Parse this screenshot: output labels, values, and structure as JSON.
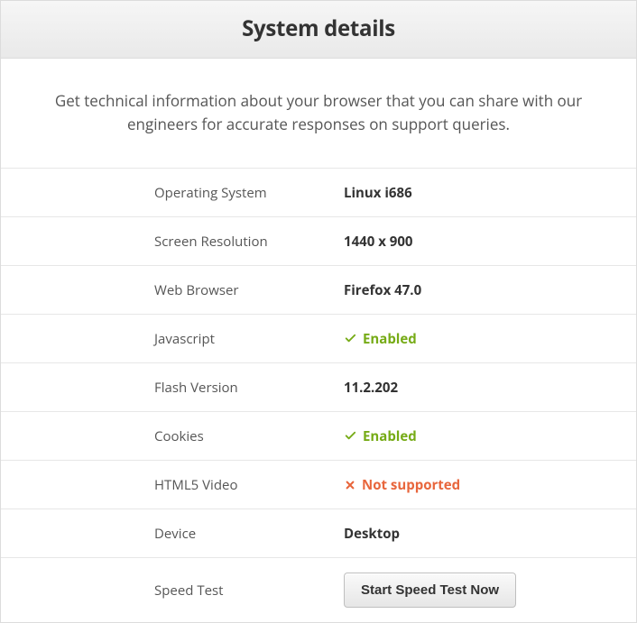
{
  "header": {
    "title": "System details"
  },
  "intro": "Get technical information about your browser that you can share with our engineers for accurate responses on support queries.",
  "rows": {
    "os": {
      "label": "Operating System",
      "value": "Linux i686"
    },
    "screen": {
      "label": "Screen Resolution",
      "value": "1440 x 900"
    },
    "browser": {
      "label": "Web Browser",
      "value": "Firefox 47.0"
    },
    "js": {
      "label": "Javascript",
      "value": "Enabled"
    },
    "flash": {
      "label": "Flash Version",
      "value": "11.2.202"
    },
    "cookies": {
      "label": "Cookies",
      "value": "Enabled"
    },
    "html5": {
      "label": "HTML5 Video",
      "value": "Not supported"
    },
    "device": {
      "label": "Device",
      "value": "Desktop"
    },
    "speed": {
      "label": "Speed Test",
      "button": "Start Speed Test Now"
    }
  }
}
